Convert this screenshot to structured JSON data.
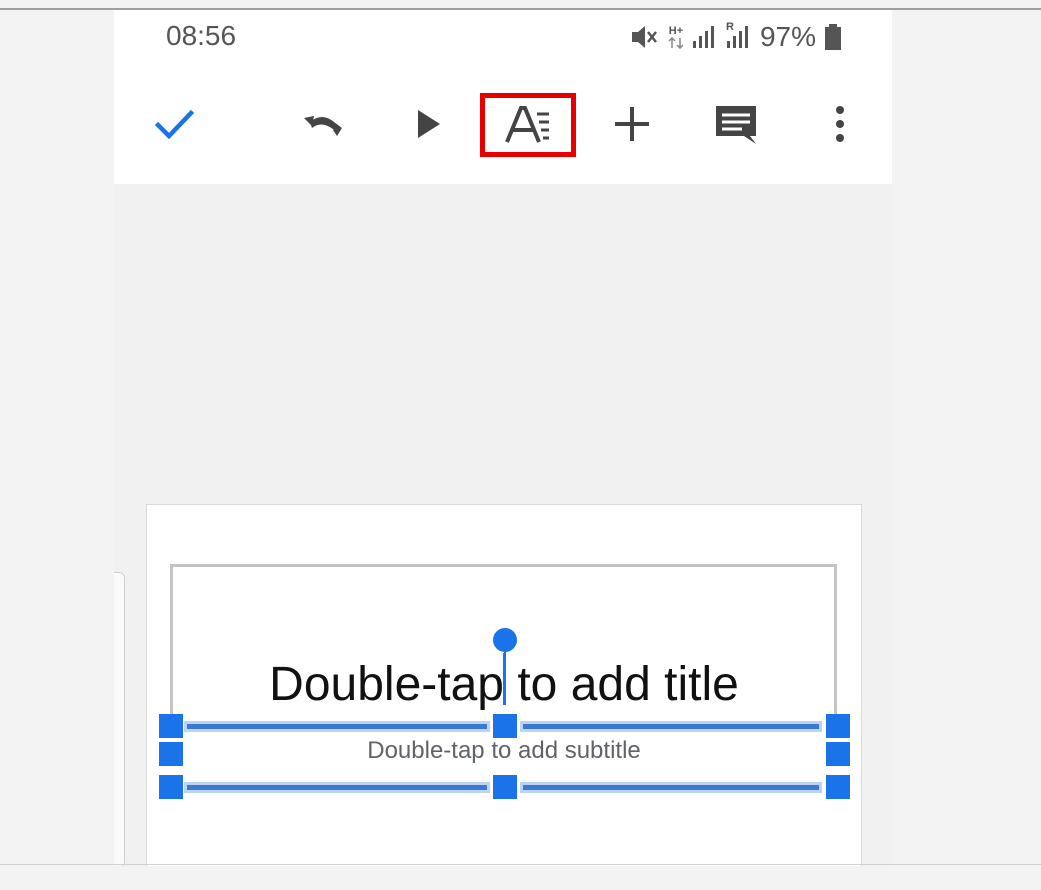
{
  "status_bar": {
    "time": "08:56",
    "network_type": "H+",
    "roaming_label": "R",
    "battery_percent": "97%"
  },
  "toolbar": {
    "icons": [
      "check-icon",
      "undo-icon",
      "play-icon",
      "text-format-icon",
      "add-icon",
      "comment-icon",
      "more-vert-icon"
    ],
    "highlight_color": "#e60000",
    "accent_color": "#1a73e8"
  },
  "slide": {
    "title_placeholder": "Double-tap to add title",
    "subtitle_placeholder": "Double-tap to add subtitle",
    "selection_color": "#1a73e8"
  }
}
